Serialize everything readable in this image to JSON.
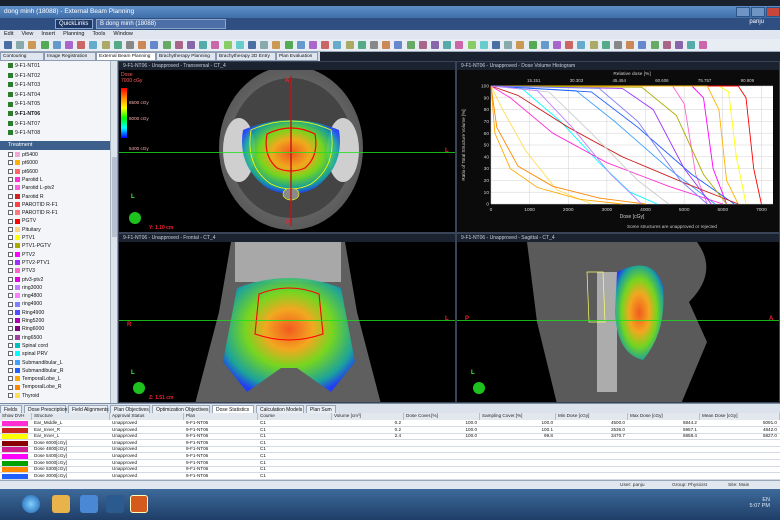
{
  "window": {
    "title": "dong minh (18088) - External Beam Planning",
    "quick_links": "QuickLinks",
    "patient": "B dong minh (18088)",
    "user": "panju"
  },
  "menu": [
    "Edit",
    "View",
    "Insert",
    "Planning",
    "Tools",
    "Window"
  ],
  "workspace_tabs": [
    "Contouring",
    "Image Registration",
    "External Beam Planning",
    "Brachytherapy Planning",
    "Brachytherapy 2D Entry",
    "Plan Evaluation"
  ],
  "plans": [
    "9-F1-NT01",
    "9-F1-NT02",
    "9-F1-NT03",
    "9-F1-NT04",
    "9-F1-NT05",
    "9-F1-NT06",
    "9-F1-NT07",
    "9-F1-NT08"
  ],
  "selected_plan": "9-F1-NT06",
  "treatment_label": "Treatment",
  "structures": [
    {
      "name": "pt5400",
      "color": "#f2a7d6"
    },
    {
      "name": "pt6000",
      "color": "#ffb000"
    },
    {
      "name": "pt6600",
      "color": "#ff6666"
    },
    {
      "name": "Parotid L",
      "color": "#ff2fd4"
    },
    {
      "name": "Parotid L-ptv2",
      "color": "#ff62e0"
    },
    {
      "name": "Parotid R",
      "color": "#cc2222"
    },
    {
      "name": "PAROTID R-F1",
      "color": "#ff4040"
    },
    {
      "name": "PAROTID R-F1",
      "color": "#ff7a7a"
    },
    {
      "name": "PGTV",
      "color": "#ff0000"
    },
    {
      "name": "Pituitary",
      "color": "#ffd27f"
    },
    {
      "name": "PTV1",
      "color": "#ffff00"
    },
    {
      "name": "PTV1-PGTV",
      "color": "#aaaa00"
    },
    {
      "name": "PTV2",
      "color": "#ff00ff"
    },
    {
      "name": "PTV2-PTV1",
      "color": "#9b30ff"
    },
    {
      "name": "PTV3",
      "color": "#ff66cc"
    },
    {
      "name": "ptv3-ptv2",
      "color": "#e000e0"
    },
    {
      "name": "ring3000",
      "color": "#c080ff"
    },
    {
      "name": "ring4800",
      "color": "#ff7fff"
    },
    {
      "name": "ring4900",
      "color": "#7f7fff"
    },
    {
      "name": "Ring4900",
      "color": "#4f4fff"
    },
    {
      "name": "Ring5200",
      "color": "#b000b0"
    },
    {
      "name": "Ring6000",
      "color": "#800080"
    },
    {
      "name": "ring6500",
      "color": "#a040a0"
    },
    {
      "name": "Spinal cord",
      "color": "#00c0c0"
    },
    {
      "name": "spinal PRV",
      "color": "#00ffff"
    },
    {
      "name": "Submandibular_L",
      "color": "#40a0ff"
    },
    {
      "name": "Submandibular_R",
      "color": "#2060ff"
    },
    {
      "name": "TemporalLobe_L",
      "color": "#ffaa00"
    },
    {
      "name": "TemporalLobe_R",
      "color": "#ff8800"
    },
    {
      "name": "Thyroid",
      "color": "#ffdd55"
    }
  ],
  "viewports": {
    "transversal": "9-F1-NT06 - Unapproved - Transversal - CT_4",
    "dvh": "9-F1-NT06 - Unapproved - Dose Volume Histogram",
    "frontal": "9-F1-NT06 - Unapproved - Frontal - CT_4",
    "sagittal": "9-F1-NT06 - Unapproved - Sagittal - CT_4"
  },
  "dose_legend": {
    "title": "Dose",
    "max": "7000 cGy",
    "levels": [
      "6500 cGy",
      "6000 cGy",
      "5400 cGy"
    ]
  },
  "scalebars": {
    "transversal": "Y: 1.10 cm",
    "frontal": "Z: 1.51 cm"
  },
  "dvh_note": "Some structures are unapproved or rejected",
  "chart_data": {
    "type": "line",
    "title": "",
    "xlabel": "Dose [cGy]",
    "ylabel": "Ratio of Total Structure Volume [%]",
    "top_axis_label": "Relative dose [%]",
    "top_ticks": [
      "15.151",
      "30.303",
      "45.454",
      "60.606",
      "75.757",
      "90.909"
    ],
    "xlim": [
      0,
      7300
    ],
    "ylim": [
      0,
      100
    ],
    "xticks": [
      0,
      1000,
      2000,
      3000,
      4000,
      5000,
      6000,
      7000
    ],
    "yticks": [
      0,
      10,
      20,
      30,
      40,
      50,
      60,
      70,
      80,
      90,
      100
    ],
    "grid": true,
    "series": [
      {
        "color": "#ffff00",
        "x": [
          0,
          5900,
          6150,
          6350,
          6600
        ],
        "y": [
          100,
          100,
          95,
          40,
          0
        ]
      },
      {
        "color": "#ff00ff",
        "x": [
          0,
          5200,
          5500,
          5750,
          6100
        ],
        "y": [
          100,
          100,
          90,
          30,
          0
        ]
      },
      {
        "color": "#ff0000",
        "x": [
          0,
          6400,
          6600,
          6800,
          7000
        ],
        "y": [
          100,
          100,
          90,
          30,
          0
        ]
      },
      {
        "color": "#ff66cc",
        "x": [
          0,
          4700,
          5000,
          5300,
          5600
        ],
        "y": [
          100,
          100,
          85,
          25,
          0
        ]
      },
      {
        "color": "#ffb000",
        "x": [
          0,
          5600,
          5900,
          6100,
          6400
        ],
        "y": [
          100,
          100,
          80,
          20,
          0
        ]
      },
      {
        "color": "#00ffff",
        "x": [
          0,
          800,
          1800,
          2800,
          3600,
          4300
        ],
        "y": [
          100,
          98,
          70,
          35,
          10,
          0
        ]
      },
      {
        "color": "#40a0ff",
        "x": [
          0,
          2200,
          3200,
          4600,
          5800
        ],
        "y": [
          100,
          96,
          70,
          30,
          0
        ]
      },
      {
        "color": "#2060ff",
        "x": [
          0,
          2600,
          3800,
          5200,
          6300
        ],
        "y": [
          100,
          95,
          65,
          25,
          0
        ]
      },
      {
        "color": "#ff2fd4",
        "x": [
          0,
          500,
          1600,
          3000,
          4600,
          6000
        ],
        "y": [
          100,
          90,
          60,
          35,
          15,
          0
        ]
      },
      {
        "color": "#cc2222",
        "x": [
          0,
          700,
          2000,
          3400,
          5000,
          6400
        ],
        "y": [
          100,
          92,
          65,
          40,
          18,
          0
        ]
      },
      {
        "color": "#ffdd55",
        "x": [
          0,
          300,
          900,
          1700,
          2600
        ],
        "y": [
          100,
          80,
          45,
          12,
          0
        ]
      },
      {
        "color": "#ffaa00",
        "x": [
          0,
          100,
          500,
          1200,
          2300,
          3400
        ],
        "y": [
          100,
          60,
          30,
          14,
          4,
          0
        ]
      },
      {
        "color": "#ff8800",
        "x": [
          0,
          150,
          700,
          1600,
          2800,
          4000
        ],
        "y": [
          100,
          65,
          32,
          15,
          5,
          0
        ]
      },
      {
        "color": "#9b30ff",
        "x": [
          0,
          3400,
          4200,
          5000,
          5700
        ],
        "y": [
          100,
          98,
          80,
          30,
          0
        ]
      },
      {
        "color": "#aaaa00",
        "x": [
          0,
          3900,
          4800,
          5500,
          6100
        ],
        "y": [
          100,
          99,
          75,
          25,
          0
        ]
      },
      {
        "color": "#ffffff",
        "x": [
          0,
          1500,
          2600,
          3800,
          4600
        ],
        "y": [
          100,
          95,
          60,
          20,
          0
        ]
      },
      {
        "color": "#7f7fff",
        "x": [
          0,
          2800,
          3800,
          4900,
          5600
        ],
        "y": [
          100,
          98,
          70,
          20,
          0
        ]
      },
      {
        "color": "#c080ff",
        "x": [
          0,
          1200,
          2100,
          3100,
          3900
        ],
        "y": [
          100,
          96,
          65,
          25,
          0
        ]
      }
    ]
  },
  "bottom_tabs": [
    "Fields",
    "Dose Prescription",
    "Field Alignments",
    "Plan Objectives",
    "Optimization Objectives",
    "Dose Statistics",
    "Calculation Models",
    "Plan Sum"
  ],
  "active_bottom_tab": "Dose Statistics",
  "grid": {
    "headers": [
      "Show DVH",
      "Structure",
      "Approval Status",
      "Plan",
      "Course",
      "Volume [cm³]",
      "Dose Cover.[%]",
      "Sampling Cover.[%]",
      "Min Dose [cGy]",
      "Max Dose [cGy]",
      "Mean Dose [cGy]"
    ],
    "rows": [
      {
        "swatch": "#ff2fd4",
        "cells": [
          "Ear_Middle_L",
          "Unapproved",
          "9-F1-NT06",
          "C1",
          "0.2",
          "100.0",
          "100.0",
          "4500.0",
          "5844.2",
          "5091.0"
        ]
      },
      {
        "swatch": "#cc2222",
        "cells": [
          "Ear_Inner_R",
          "Unapproved",
          "9-F1-NT06",
          "C1",
          "0.2",
          "100.0",
          "100.1",
          "2536.0",
          "5957.1",
          "4842.0"
        ]
      },
      {
        "swatch": "#ffff00",
        "cells": [
          "Ear_Inner_L",
          "Unapproved",
          "9-F1-NT06",
          "C1",
          "2.4",
          "100.0",
          "99.8",
          "3470.7",
          "6858.4",
          "5827.0"
        ]
      },
      {
        "swatch": "#8b0000",
        "cells": [
          "Dose 6000[cGy]",
          "Unapproved",
          "9-F1-NT06",
          "C1",
          "",
          "",
          "",
          "",
          "",
          ""
        ]
      },
      {
        "swatch": "#d02090",
        "cells": [
          "Dose 4800[cGy]",
          "Unapproved",
          "9-F1-NT06",
          "C1",
          "",
          "",
          "",
          "",
          "",
          ""
        ]
      },
      {
        "swatch": "#ff00ff",
        "cells": [
          "Dose 5400[cGy]",
          "Unapproved",
          "9-F1-NT06",
          "C1",
          "",
          "",
          "",
          "",
          "",
          ""
        ]
      },
      {
        "swatch": "#00a000",
        "cells": [
          "Dose 5000[cGy]",
          "Unapproved",
          "9-F1-NT06",
          "C1",
          "",
          "",
          "",
          "",
          "",
          ""
        ]
      },
      {
        "swatch": "#ff8800",
        "cells": [
          "Dose 5300[cGy]",
          "Unapproved",
          "9-F1-NT06",
          "C1",
          "",
          "",
          "",
          "",
          "",
          ""
        ]
      },
      {
        "swatch": "#2060ff",
        "cells": [
          "Dose 3000[cGy]",
          "Unapproved",
          "9-F1-NT06",
          "C1",
          "",
          "",
          "",
          "",
          "",
          ""
        ]
      }
    ]
  },
  "status": {
    "user": "User: panju",
    "group": "Group: Physicist",
    "site": "Site: Main"
  },
  "clock": {
    "time": "5:07 PM",
    "lang": "EN"
  }
}
